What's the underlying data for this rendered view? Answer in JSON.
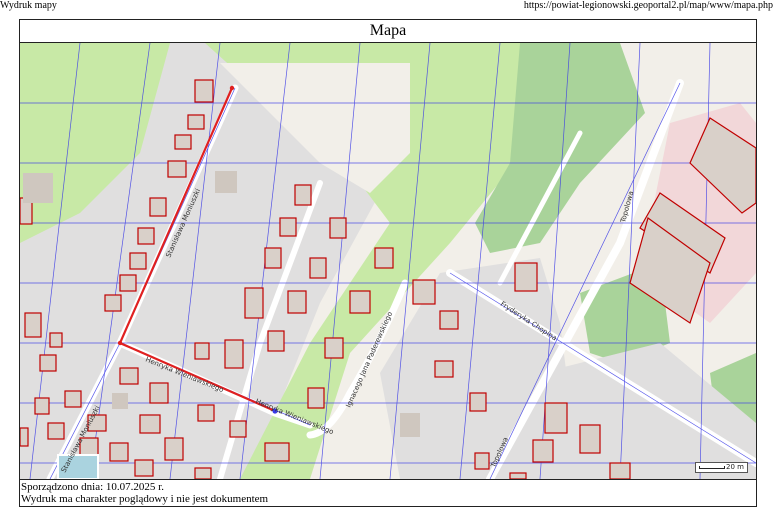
{
  "header": {
    "left": "Wydruk mapy",
    "right": "https://powiat-legionowski.geoportal2.pl/map/www/mapa.php"
  },
  "title": "Mapa",
  "map": {
    "street_labels": [
      "Stanisława Moniuszki",
      "Stanisława Moniuszki",
      "Henryka Wieniawskiego",
      "Henryka Wieniawskiego",
      "Ignacego Jana Paderewskiego",
      "Fryderyka Chopina",
      "Topolowa",
      "Topolowa"
    ],
    "scale_label": "20 m",
    "colors": {
      "background": "#f2efe9",
      "residential": "#e0dfdf",
      "grass": "#c8e9a6",
      "forest": "#a9d39a",
      "industrial": "#f2d7d9",
      "parcel": "#3a3ae6",
      "building": "#c00000",
      "route": "#e02020",
      "road": "#ffffff"
    }
  },
  "footer": {
    "date_line": "Sporządzono dnia: 10.07.2025 r.",
    "note_line": "Wydruk ma charakter poglądowy i nie jest dokumentem"
  }
}
